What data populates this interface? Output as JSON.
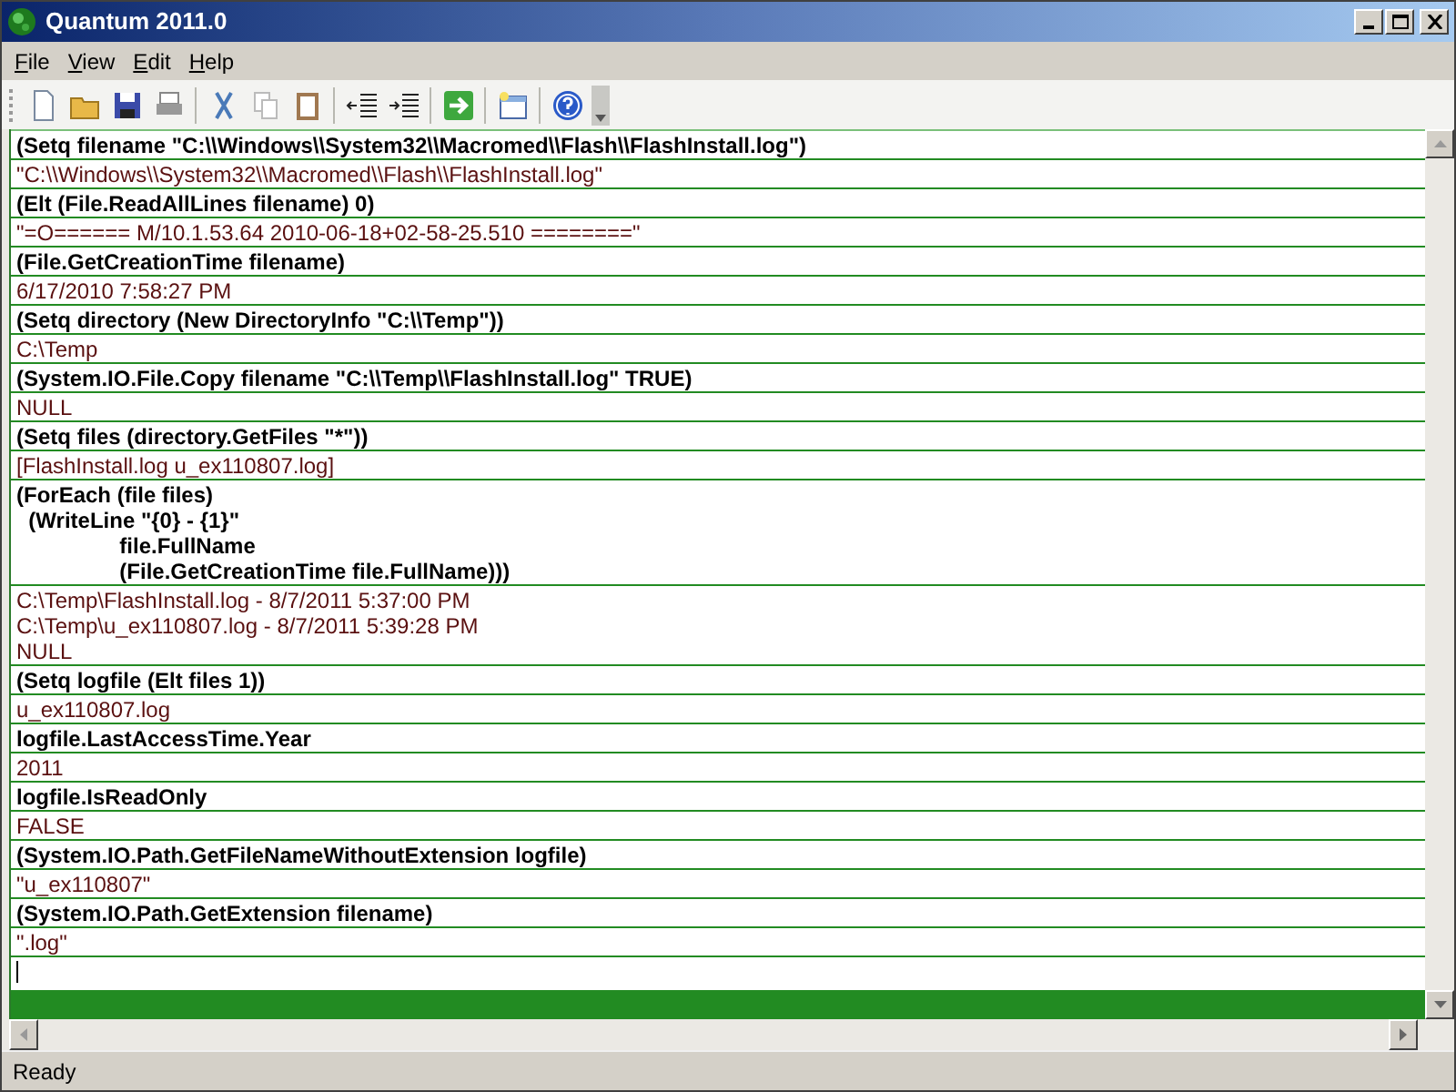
{
  "window": {
    "title": "Quantum 2011.0"
  },
  "menu": [
    "File",
    "View",
    "Edit",
    "Help"
  ],
  "entries": [
    {
      "kind": "input",
      "lines": [
        "(Setq filename \"C:\\\\Windows\\\\System32\\\\Macromed\\\\Flash\\\\FlashInstall.log\")"
      ]
    },
    {
      "kind": "output",
      "lines": [
        "\"C:\\\\Windows\\\\System32\\\\Macromed\\\\Flash\\\\FlashInstall.log\""
      ]
    },
    {
      "kind": "input",
      "lines": [
        "(Elt (File.ReadAllLines filename) 0)"
      ]
    },
    {
      "kind": "output",
      "lines": [
        "\"=O====== M/10.1.53.64 2010-06-18+02-58-25.510 ========\""
      ]
    },
    {
      "kind": "input",
      "lines": [
        "(File.GetCreationTime filename)"
      ]
    },
    {
      "kind": "output",
      "lines": [
        "6/17/2010 7:58:27 PM"
      ]
    },
    {
      "kind": "input",
      "lines": [
        "(Setq directory (New DirectoryInfo \"C:\\\\Temp\"))"
      ]
    },
    {
      "kind": "output",
      "lines": [
        "C:\\Temp"
      ]
    },
    {
      "kind": "input",
      "lines": [
        "(System.IO.File.Copy filename \"C:\\\\Temp\\\\FlashInstall.log\" TRUE)"
      ]
    },
    {
      "kind": "output",
      "lines": [
        "NULL"
      ]
    },
    {
      "kind": "input",
      "lines": [
        "(Setq files (directory.GetFiles \"*\"))"
      ]
    },
    {
      "kind": "output",
      "lines": [
        "[FlashInstall.log u_ex110807.log]"
      ]
    },
    {
      "kind": "input",
      "lines": [
        "(ForEach (file files)",
        "  (WriteLine \"{0} - {1}\"",
        "                 file.FullName",
        "                 (File.GetCreationTime file.FullName)))"
      ]
    },
    {
      "kind": "output",
      "lines": [
        "C:\\Temp\\FlashInstall.log - 8/7/2011 5:37:00 PM",
        "C:\\Temp\\u_ex110807.log - 8/7/2011 5:39:28 PM",
        "NULL"
      ]
    },
    {
      "kind": "input",
      "lines": [
        "(Setq logfile (Elt files 1))"
      ]
    },
    {
      "kind": "output",
      "lines": [
        "u_ex110807.log"
      ]
    },
    {
      "kind": "input",
      "lines": [
        "logfile.LastAccessTime.Year"
      ]
    },
    {
      "kind": "output",
      "lines": [
        "2011"
      ]
    },
    {
      "kind": "input",
      "lines": [
        "logfile.IsReadOnly"
      ]
    },
    {
      "kind": "output",
      "lines": [
        "FALSE"
      ]
    },
    {
      "kind": "input",
      "lines": [
        "(System.IO.Path.GetFileNameWithoutExtension logfile)"
      ]
    },
    {
      "kind": "output",
      "lines": [
        "\"u_ex110807\""
      ]
    },
    {
      "kind": "input",
      "lines": [
        "(System.IO.Path.GetExtension filename)"
      ]
    },
    {
      "kind": "output",
      "lines": [
        "\".log\""
      ]
    }
  ],
  "status_bar": "Ready"
}
